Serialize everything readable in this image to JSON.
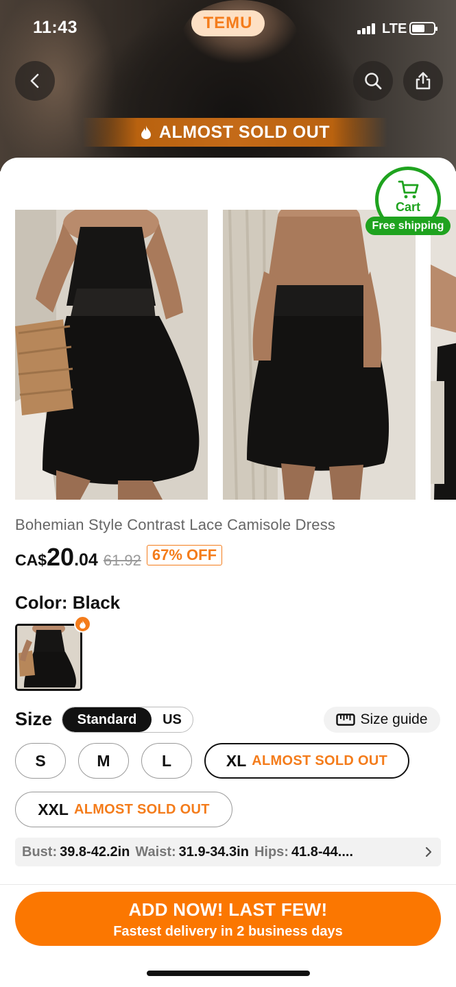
{
  "status_bar": {
    "time": "11:43",
    "network": "LTE"
  },
  "brand": "TEMU",
  "banner": {
    "text": "ALMOST SOLD OUT",
    "icon": "flame-icon"
  },
  "header_icons": {
    "back": "back-chevron-icon",
    "search": "search-icon",
    "share": "share-icon"
  },
  "cart": {
    "label": "Cart",
    "badge": "Free shipping",
    "icon": "cart-icon",
    "accent": "#1fa31f"
  },
  "product": {
    "title": "Bohemian Style Contrast Lace Camisole Dress",
    "currency": "CA$",
    "price_int": "20",
    "price_dec": ".04",
    "original_price": "61.92",
    "discount": "67% OFF"
  },
  "color": {
    "label": "Color: Black",
    "selected": "Black"
  },
  "size": {
    "label": "Size",
    "unit_options": [
      "Standard",
      "US"
    ],
    "unit_selected": "Standard",
    "guide_label": "Size guide",
    "options": [
      {
        "name": "S",
        "note": ""
      },
      {
        "name": "M",
        "note": ""
      },
      {
        "name": "L",
        "note": ""
      },
      {
        "name": "XL",
        "note": "ALMOST SOLD OUT"
      },
      {
        "name": "XXL",
        "note": "ALMOST SOLD OUT"
      }
    ],
    "selected": "XL"
  },
  "measurements": [
    {
      "key": "Bust:",
      "value": "39.8-42.2in"
    },
    {
      "key": "Waist:",
      "value": "31.9-34.3in"
    },
    {
      "key": "Hips:",
      "value": "41.8-44...."
    }
  ],
  "cta": {
    "main": "ADD NOW! LAST FEW!",
    "sub": "Fastest delivery in 2 business days"
  },
  "colors": {
    "accent": "#fb7701",
    "warning": "#f47c1b",
    "text": "#111111"
  }
}
